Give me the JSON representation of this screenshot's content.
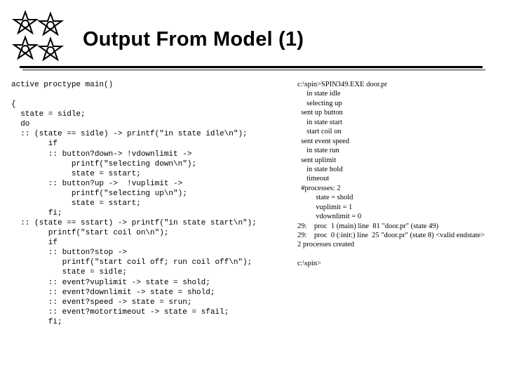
{
  "header": {
    "title": "Output From Model (1)"
  },
  "code": {
    "text": "active proctype main()\n\n{\n  state = sidle;\n  do\n  :: (state == sidle) -> printf(\"in state idle\\n\");\n        if\n        :: button?down-> !vdownlimit ->\n             printf(\"selecting down\\n\");\n             state = sstart;\n        :: button?up ->  !vuplimit ->\n             printf(\"selecting up\\n\");\n             state = sstart;\n        fi;\n  :: (state == sstart) -> printf(\"in state start\\n\");\n        printf(\"start coil on\\n\");\n        if\n        :: button?stop ->\n           printf(\"start coil off; run coil off\\n\");\n           state = sidle;\n        :: event?vuplimit -> state = shold;\n        :: event?downlimit -> state = shold;\n        :: event?speed -> state = srun;\n        :: event?motortimeout -> state = sfail;\n        fi;"
  },
  "trace": {
    "text": "c:\\spin>SPIN349.EXE door.pr\n     in state idle\n     selecting up\n  sent up button\n     in state start\n     start coil on\n  sent event speed\n     in state run\n  sent uplimit\n     in state hold\n     timeout\n  #processes: 2\n          state = shold\n          vuplimit = 1\n          vdownlimit = 0\n29:    proc  1 (main) line  81 \"door.pr\" (state 49)\n29:    proc  0 (:init:) line  25 \"door.pr\" (state 8) <valid endstate>\n2 processes created\n\nc:\\spin>"
  }
}
